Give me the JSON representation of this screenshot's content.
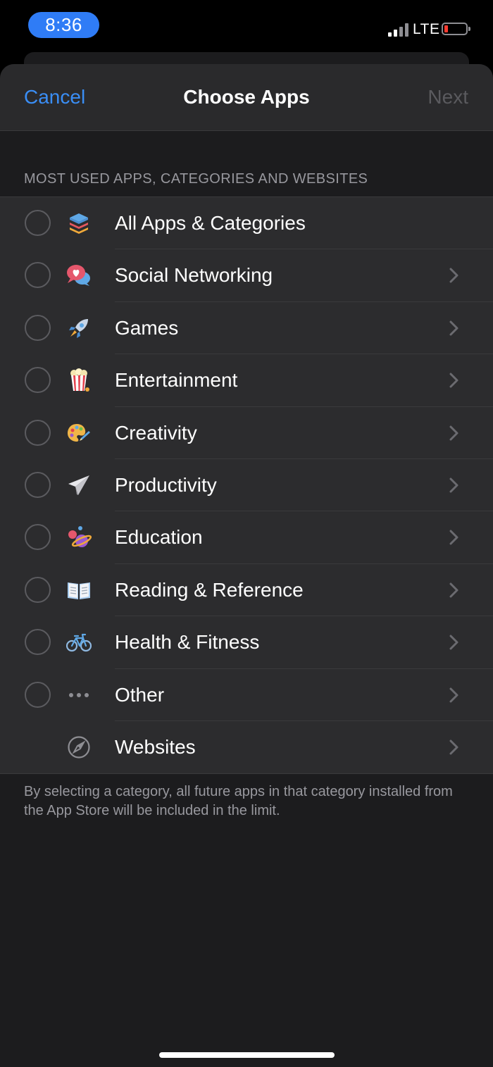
{
  "status_bar": {
    "time": "8:36",
    "network": "LTE",
    "battery_color": "#ff3b30"
  },
  "nav": {
    "cancel": "Cancel",
    "title": "Choose Apps",
    "next": "Next"
  },
  "section_header": "MOST USED APPS, CATEGORIES AND WEBSITES",
  "items": [
    {
      "label": "All Apps & Categories",
      "icon": "stack-icon",
      "has_radio": true,
      "has_chevron": false
    },
    {
      "label": "Social Networking",
      "icon": "chat-bubble-heart-icon",
      "has_radio": true,
      "has_chevron": true
    },
    {
      "label": "Games",
      "icon": "rocket-icon",
      "has_radio": true,
      "has_chevron": true
    },
    {
      "label": "Entertainment",
      "icon": "popcorn-icon",
      "has_radio": true,
      "has_chevron": true
    },
    {
      "label": "Creativity",
      "icon": "paint-palette-icon",
      "has_radio": true,
      "has_chevron": true
    },
    {
      "label": "Productivity",
      "icon": "paper-plane-icon",
      "has_radio": true,
      "has_chevron": true
    },
    {
      "label": "Education",
      "icon": "planet-icon",
      "has_radio": true,
      "has_chevron": true
    },
    {
      "label": "Reading & Reference",
      "icon": "open-book-icon",
      "has_radio": true,
      "has_chevron": true
    },
    {
      "label": "Health & Fitness",
      "icon": "bicycle-icon",
      "has_radio": true,
      "has_chevron": true
    },
    {
      "label": "Other",
      "icon": "ellipsis-icon",
      "has_radio": true,
      "has_chevron": true
    },
    {
      "label": "Websites",
      "icon": "compass-icon",
      "has_radio": false,
      "has_chevron": true
    }
  ],
  "footer_note": "By selecting a category, all future apps in that category installed from the App Store will be included in the limit.",
  "colors": {
    "accent": "#3a8ef6",
    "disabled": "#5a5a5e",
    "time_pill": "#2f7cf6"
  }
}
